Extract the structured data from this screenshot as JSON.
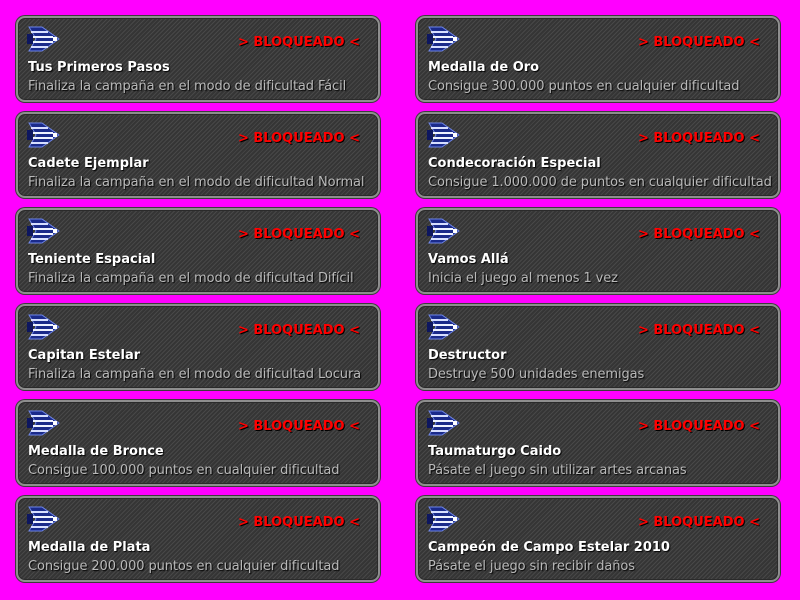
{
  "status_label": "> BLOQUEADO <",
  "colors": {
    "background": "#ff00ff",
    "status": "#ff0000",
    "title": "#ffffff",
    "description": "#b9b9b9"
  },
  "achievements": [
    {
      "icon": "spaceship-icon",
      "title": "Tus Primeros Pasos",
      "description": "Finaliza la campaña en el modo de dificultad Fácil",
      "status": "> BLOQUEADO <"
    },
    {
      "icon": "spaceship-icon",
      "title": "Medalla de Oro",
      "description": "Consigue 300.000 puntos en cualquier dificultad",
      "status": "> BLOQUEADO <"
    },
    {
      "icon": "spaceship-icon",
      "title": "Cadete Ejemplar",
      "description": "Finaliza la campaña en el modo de dificultad Normal",
      "status": "> BLOQUEADO <"
    },
    {
      "icon": "spaceship-icon",
      "title": "Condecoración Especial",
      "description": "Consigue 1.000.000 de puntos en cualquier dificultad",
      "status": "> BLOQUEADO <"
    },
    {
      "icon": "spaceship-icon",
      "title": "Teniente Espacial",
      "description": "Finaliza la campaña en el modo de dificultad Difícil",
      "status": "> BLOQUEADO <"
    },
    {
      "icon": "spaceship-icon",
      "title": "Vamos Allá",
      "description": "Inicia el juego al menos 1 vez",
      "status": "> BLOQUEADO <"
    },
    {
      "icon": "spaceship-icon",
      "title": "Capitan Estelar",
      "description": "Finaliza la campaña en el modo de dificultad Locura",
      "status": "> BLOQUEADO <"
    },
    {
      "icon": "spaceship-icon",
      "title": "Destructor",
      "description": "Destruye 500 unidades enemigas",
      "status": "> BLOQUEADO <"
    },
    {
      "icon": "spaceship-icon",
      "title": "Medalla de Bronce",
      "description": "Consigue 100.000 puntos en cualquier dificultad",
      "status": "> BLOQUEADO <"
    },
    {
      "icon": "spaceship-icon",
      "title": "Taumaturgo Caido",
      "description": "Pásate el juego sin utilizar artes arcanas",
      "status": "> BLOQUEADO <"
    },
    {
      "icon": "spaceship-icon",
      "title": "Medalla de Plata",
      "description": "Consigue 200.000 puntos en cualquier dificultad",
      "status": "> BLOQUEADO <"
    },
    {
      "icon": "spaceship-icon",
      "title": "Campeón de Campo Estelar 2010",
      "description": "Pásate el juego sin recibir daños",
      "status": "> BLOQUEADO <"
    }
  ]
}
